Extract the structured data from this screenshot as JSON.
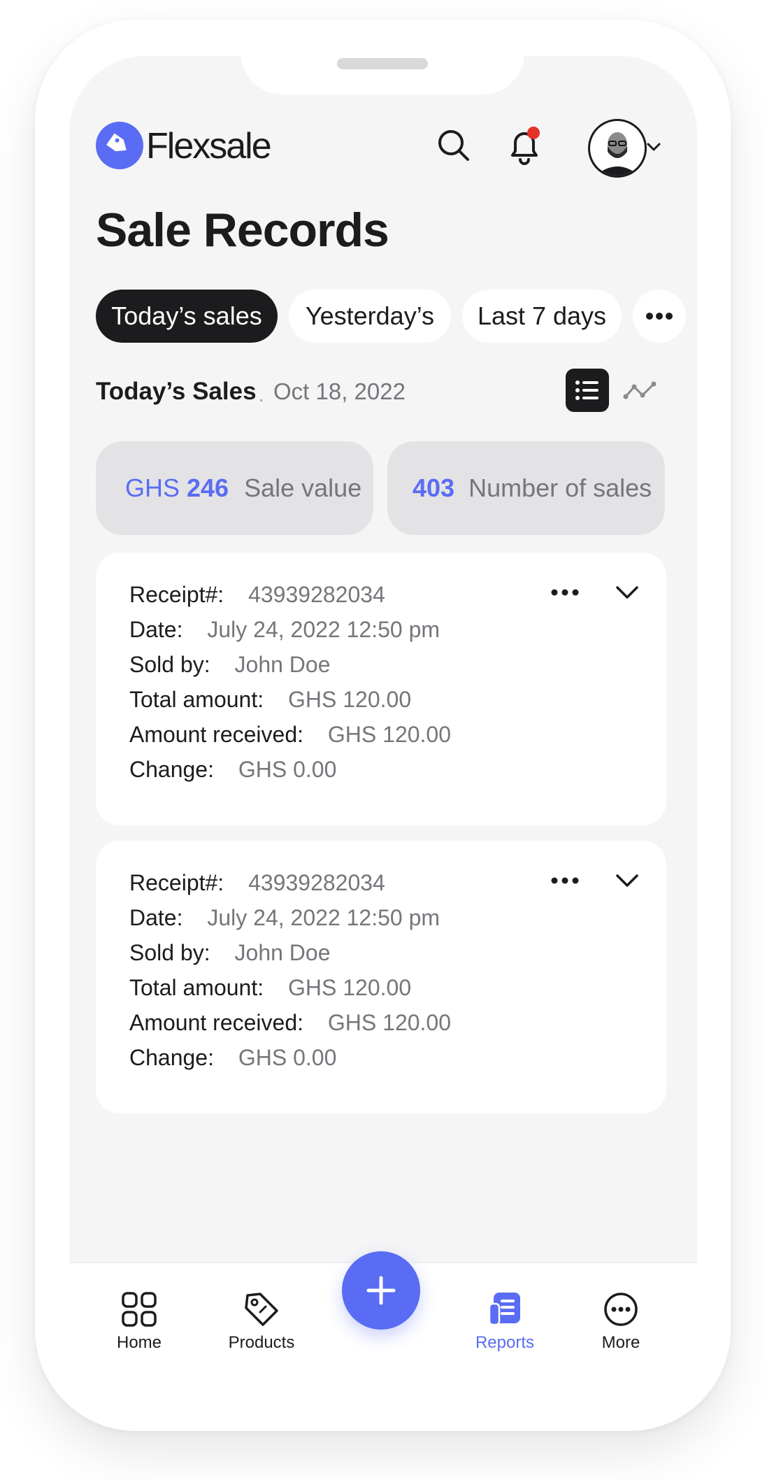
{
  "app": {
    "brand": "Flexsale",
    "page_title": "Sale Records"
  },
  "filters": {
    "tabs": [
      {
        "label": "Today’s sales",
        "active": true
      },
      {
        "label": "Yesterday’s",
        "active": false
      },
      {
        "label": "Last 7 days",
        "active": false
      }
    ],
    "more_icon": "ellipsis-icon"
  },
  "section": {
    "title": "Today’s Sales",
    "separator": "·",
    "date": "Oct 18, 2022"
  },
  "stats": {
    "sale_value": {
      "currency": "GHS",
      "amount": "246",
      "label": "Sale value"
    },
    "number_of_sales": {
      "amount": "403",
      "label": "Number of sales"
    }
  },
  "receipts": [
    {
      "receipt_label": "Receipt#:",
      "receipt_no": "43939282034",
      "date_label": "Date:",
      "date": "July 24, 2022 12:50 pm",
      "sold_by_label": "Sold by:",
      "sold_by": "John Doe",
      "total_label": "Total amount:",
      "total": "GHS 120.00",
      "received_label": "Amount received:",
      "received": "GHS 120.00",
      "change_label": "Change:",
      "change": "GHS 0.00"
    },
    {
      "receipt_label": "Receipt#:",
      "receipt_no": "43939282034",
      "date_label": "Date:",
      "date": "July 24, 2022 12:50 pm",
      "sold_by_label": "Sold by:",
      "sold_by": "John Doe",
      "total_label": "Total amount:",
      "total": "GHS 120.00",
      "received_label": "Amount received:",
      "received": "GHS 120.00",
      "change_label": "Change:",
      "change": "GHS 0.00"
    }
  ],
  "bottom_nav": {
    "items": [
      {
        "label": "Home",
        "icon": "grid-icon",
        "active": false
      },
      {
        "label": "Products",
        "icon": "tag-icon",
        "active": false
      },
      {
        "label": "Reports",
        "icon": "report-icon",
        "active": true
      },
      {
        "label": "More",
        "icon": "more-circle-icon",
        "active": false
      }
    ],
    "fab_icon": "plus-icon"
  },
  "colors": {
    "accent": "#5a6cf3",
    "dark": "#1c1c1e",
    "notification": "#e5332a",
    "screen_bg": "#f5f5f6",
    "stat_bg": "#e3e3e6"
  }
}
